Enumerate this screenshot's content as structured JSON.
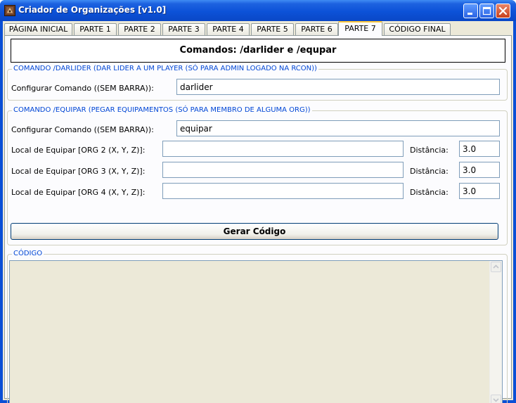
{
  "window": {
    "title": "Criador de Organizações [v1.0]"
  },
  "tabs": [
    {
      "label": "PÁGINA INICIAL",
      "active": false
    },
    {
      "label": "PARTE 1",
      "active": false
    },
    {
      "label": "PARTE 2",
      "active": false
    },
    {
      "label": "PARTE 3",
      "active": false
    },
    {
      "label": "PARTE 4",
      "active": false
    },
    {
      "label": "PARTE 5",
      "active": false
    },
    {
      "label": "PARTE 6",
      "active": false
    },
    {
      "label": "PARTE 7",
      "active": true
    },
    {
      "label": "CÓDIGO FINAL",
      "active": false
    }
  ],
  "header": {
    "text": "Comandos: /darlider e /equpar"
  },
  "darlider_group": {
    "legend": "COMANDO  /DARLIDER   (DAR LIDER A UM PLAYER (SÓ PARA ADMIN LOGADO NA RCON))",
    "config_label": "Configurar Comando ((SEM BARRA)):",
    "config_value": "darlider"
  },
  "equipar_group": {
    "legend": "COMANDO  /EQUIPAR   (PEGAR EQUIPAMENTOS (SÓ PARA MEMBRO DE ALGUMA ORG))",
    "config_label": "Configurar Comando ((SEM BARRA)):",
    "config_value": "equipar",
    "locals": [
      {
        "label": "Local de Equipar [ORG 2 (X, Y, Z)]:",
        "value": "",
        "distance_label": "Distância:",
        "distance": "3.0"
      },
      {
        "label": "Local de Equipar [ORG 3 (X, Y, Z)]:",
        "value": "",
        "distance_label": "Distância:",
        "distance": "3.0"
      },
      {
        "label": "Local de Equipar [ORG 4 (X, Y, Z)]:",
        "value": "",
        "distance_label": "Distância:",
        "distance": "3.0"
      }
    ],
    "generate_button": "Gerar Código"
  },
  "code_group": {
    "legend": "CÓDIGO",
    "content": ""
  },
  "icons": {
    "app": "organization-app-icon",
    "minimize": "minimize-icon",
    "maximize": "maximize-icon",
    "close": "close-icon",
    "scroll_up": "scroll-up-arrow-icon",
    "scroll_down": "scroll-down-arrow-icon"
  },
  "colors": {
    "titlebar": "#0a52d8",
    "legend_text": "#0046d5",
    "active_tab_highlight": "#ffc83c",
    "panel_bg": "#ece9d8"
  }
}
